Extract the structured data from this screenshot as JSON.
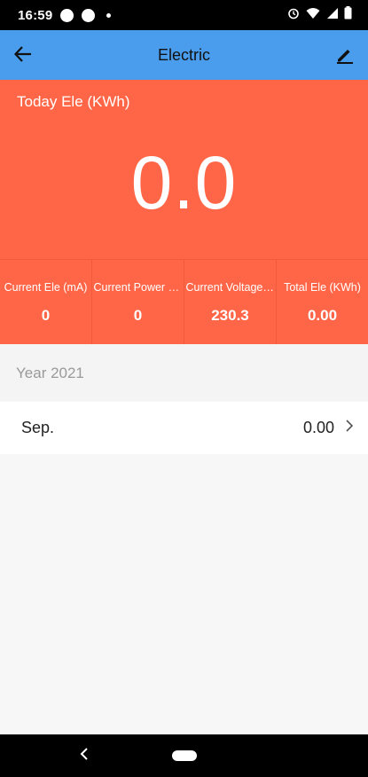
{
  "status_bar": {
    "time": "16:59",
    "icons": [
      "alarm-icon",
      "wifi-icon",
      "signal-icon",
      "battery-icon"
    ]
  },
  "app_bar": {
    "title": "Electric",
    "back_icon": "arrow-back-icon",
    "edit_icon": "pencil-icon",
    "background": "#4a9ded"
  },
  "hero": {
    "label": "Today Ele (KWh)",
    "value": "0.0",
    "background": "#ff6647"
  },
  "stats": [
    {
      "label": "Current Ele (mA)",
      "value": "0"
    },
    {
      "label": "Current Power (W)",
      "value": "0"
    },
    {
      "label": "Current Voltage(V)",
      "value": "230.3"
    },
    {
      "label": "Total Ele (KWh)",
      "value": "0.00"
    }
  ],
  "year_section": {
    "title": "Year 2021",
    "months": [
      {
        "name": "Sep.",
        "value": "0.00"
      }
    ]
  }
}
